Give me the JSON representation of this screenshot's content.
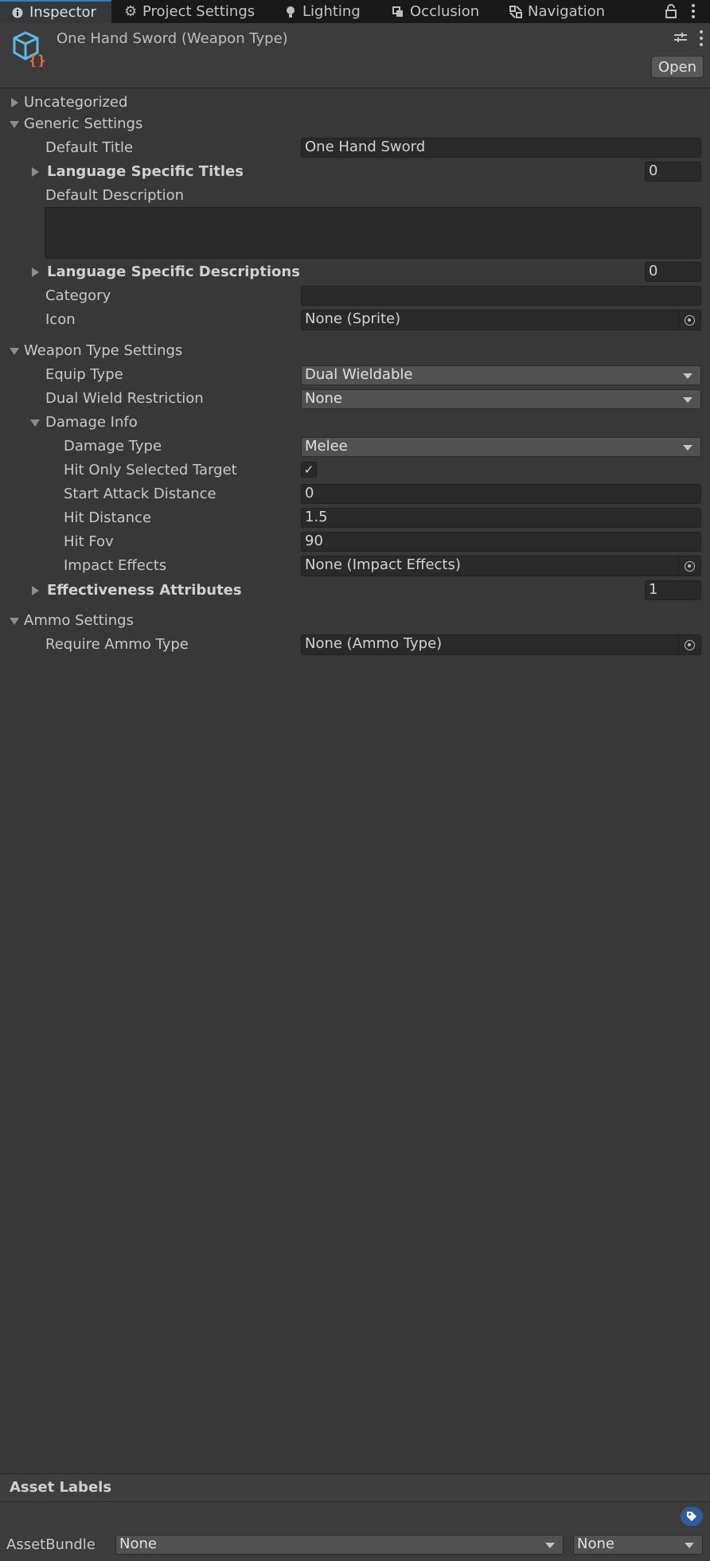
{
  "tabs": [
    {
      "label": "Inspector",
      "icon": "info-icon"
    },
    {
      "label": "Project Settings",
      "icon": "gear-icon"
    },
    {
      "label": "Lighting",
      "icon": "bulb-icon"
    },
    {
      "label": "Occlusion",
      "icon": "occlusion-icon"
    },
    {
      "label": "Navigation",
      "icon": "navigation-icon"
    }
  ],
  "header": {
    "title": "One Hand Sword (Weapon Type)",
    "open_label": "Open",
    "asset_icon": "scriptable-object-icon"
  },
  "sections": {
    "uncategorized": "Uncategorized",
    "generic": "Generic Settings",
    "weapon_type": "Weapon Type Settings",
    "damage_info": "Damage Info",
    "ammo": "Ammo Settings"
  },
  "fields": {
    "default_title": {
      "label": "Default Title",
      "value": "One Hand Sword"
    },
    "lang_titles": {
      "label": "Language Specific Titles",
      "value": "0"
    },
    "default_description": {
      "label": "Default Description",
      "value": ""
    },
    "lang_descriptions": {
      "label": "Language Specific Descriptions",
      "value": "0"
    },
    "category": {
      "label": "Category",
      "value": ""
    },
    "icon": {
      "label": "Icon",
      "value": "None (Sprite)"
    },
    "equip_type": {
      "label": "Equip Type",
      "value": "Dual Wieldable"
    },
    "dual_wield": {
      "label": "Dual Wield Restriction",
      "value": "None"
    },
    "damage_type": {
      "label": "Damage Type",
      "value": "Melee"
    },
    "hit_only_selected": {
      "label": "Hit Only Selected Target",
      "checked": true,
      "mark": "✓"
    },
    "start_attack_distance": {
      "label": "Start Attack Distance",
      "value": "0"
    },
    "hit_distance": {
      "label": "Hit Distance",
      "value": "1.5"
    },
    "hit_fov": {
      "label": "Hit Fov",
      "value": "90"
    },
    "impact_effects": {
      "label": "Impact Effects",
      "value": "None (Impact Effects)"
    },
    "effectiveness": {
      "label": "Effectiveness Attributes",
      "value": "1"
    },
    "require_ammo": {
      "label": "Require Ammo Type",
      "value": "None (Ammo Type)"
    }
  },
  "footer": {
    "asset_labels": "Asset Labels",
    "asset_bundle_label": "AssetBundle",
    "bundle_value": "None",
    "variant_value": "None"
  }
}
